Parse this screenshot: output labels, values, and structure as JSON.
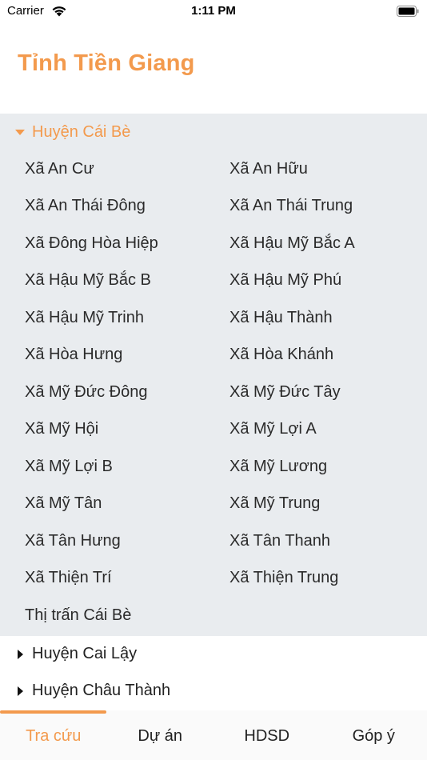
{
  "status_bar": {
    "carrier": "Carrier",
    "time": "1:11 PM"
  },
  "header": {
    "title": "Tỉnh Tiền Giang"
  },
  "colors": {
    "accent": "#f39a4d",
    "expanded_background": "#e9ecef"
  },
  "districts": [
    {
      "name": "Huyện Cái Bè",
      "expanded": true,
      "communes": [
        "Xã An Cư",
        "Xã An Hữu",
        "Xã An Thái Đông",
        "Xã An Thái Trung",
        "Xã Đông Hòa Hiệp",
        "Xã Hậu Mỹ Bắc A",
        "Xã Hậu Mỹ Bắc B",
        "Xã Hậu Mỹ Phú",
        "Xã Hậu Mỹ Trinh",
        "Xã Hậu Thành",
        "Xã Hòa Hưng",
        "Xã Hòa Khánh",
        "Xã Mỹ Đức Đông",
        "Xã Mỹ Đức Tây",
        "Xã Mỹ Hội",
        "Xã Mỹ Lợi A",
        "Xã Mỹ Lợi B",
        "Xã Mỹ Lương",
        "Xã Mỹ Tân",
        "Xã Mỹ Trung",
        "Xã Tân Hưng",
        "Xã Tân Thanh",
        "Xã Thiện Trí",
        "Xã Thiện Trung",
        "Thị trấn Cái Bè"
      ]
    },
    {
      "name": "Huyện Cai Lậy",
      "expanded": false
    },
    {
      "name": "Huyện Châu Thành",
      "expanded": false
    }
  ],
  "tabs": [
    {
      "label": "Tra cứu",
      "active": true
    },
    {
      "label": "Dự án",
      "active": false
    },
    {
      "label": "HDSD",
      "active": false
    },
    {
      "label": "Góp ý",
      "active": false
    }
  ]
}
